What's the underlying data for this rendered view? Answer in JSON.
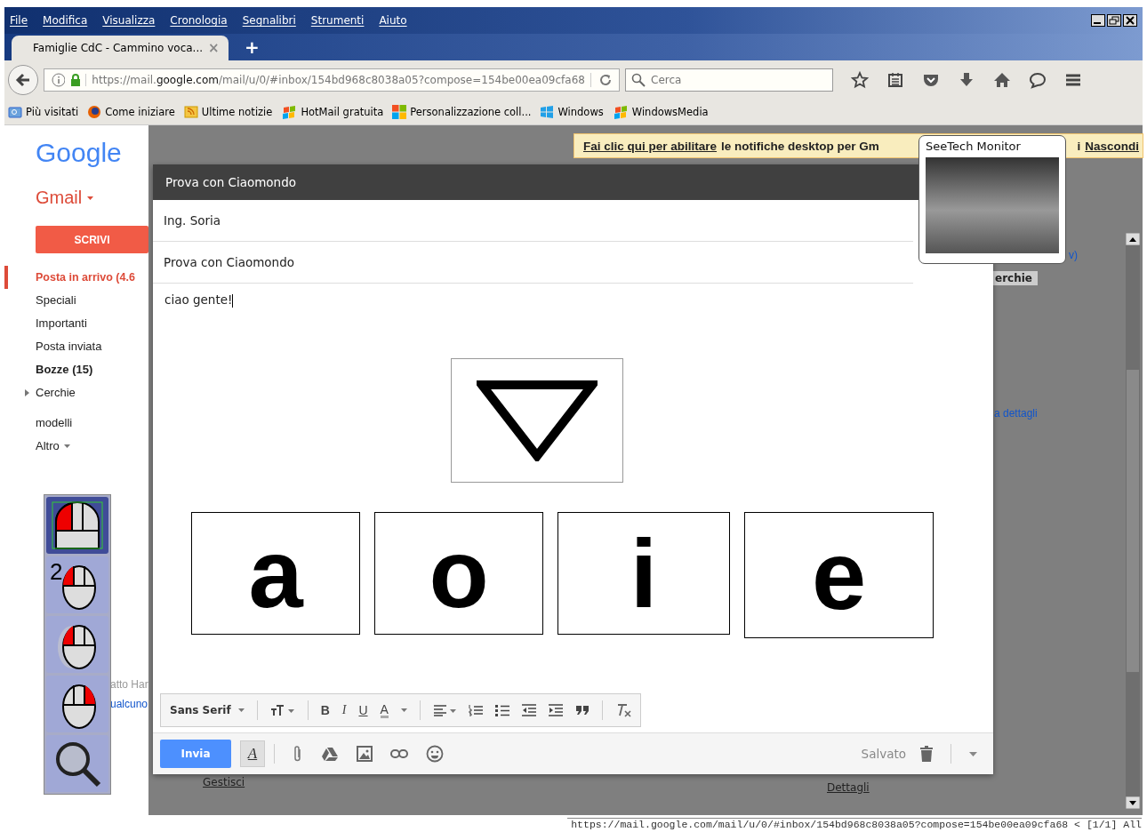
{
  "menu_bar": [
    "File",
    "Modifica",
    "Visualizza",
    "Cronologia",
    "Segnalibri",
    "Strumenti",
    "Aiuto"
  ],
  "tab": {
    "title": "Famiglie CdC - Cammino voca...",
    "close": "×",
    "new_tab": "+"
  },
  "address_bar": {
    "scheme": "https://mail.",
    "host": "google.com",
    "path": "/mail/u/0/#inbox/154bd968c8038a05?compose=154be00ea09cfa68"
  },
  "search_field": {
    "placeholder": "Cerca"
  },
  "bookmarks": [
    {
      "label": "Più visitati",
      "kind": "folder"
    },
    {
      "label": "Come iniziare",
      "kind": "firefox"
    },
    {
      "label": "Ultime notizie",
      "kind": "rss"
    },
    {
      "label": "HotMail gratuita",
      "kind": "flag"
    },
    {
      "label": "Personalizzazione coll...",
      "kind": "tiles"
    },
    {
      "label": "Windows",
      "kind": "windows"
    },
    {
      "label": "WindowsMedia",
      "kind": "flag"
    }
  ],
  "sidebar": {
    "logo": "Google",
    "app": "Gmail",
    "compose_button": "SCRIVI",
    "items": [
      {
        "label": "Posta in arrivo (4.6",
        "selected": true,
        "unread": true,
        "has_children": false
      },
      {
        "label": "Speciali",
        "selected": false,
        "unread": false,
        "has_children": false
      },
      {
        "label": "Importanti",
        "selected": false,
        "unread": false,
        "has_children": false
      },
      {
        "label": "Posta inviata",
        "selected": false,
        "unread": false,
        "has_children": false
      },
      {
        "label": "Bozze (15)",
        "selected": false,
        "unread": true,
        "has_children": false
      },
      {
        "label": "Cerchie",
        "selected": false,
        "unread": false,
        "has_children": true
      }
    ],
    "more_items": [
      {
        "label": "modelli",
        "kind": "link"
      },
      {
        "label": "Altro",
        "kind": "dropdown"
      }
    ]
  },
  "notification": {
    "link": "Fai clic qui per abilitare",
    "text": "le notifiche desktop per Gm",
    "tail": "i",
    "dismiss": "Nascondi"
  },
  "background_fragments": [
    {
      "text": "v)",
      "kind": "link"
    },
    {
      "text": "erchie",
      "kind": "chip"
    },
    {
      "text": "a dettagli",
      "kind": "link"
    },
    {
      "text": "atto Har",
      "kind": "muted"
    },
    {
      "text": "ualcuno",
      "kind": "link"
    },
    {
      "text": "Gestisci",
      "kind": "underlined"
    },
    {
      "text": "Dettagli",
      "kind": "underlined"
    }
  ],
  "compose": {
    "title": "Prova con Ciaomondo",
    "to": "Ing. Soria",
    "subject": "Prova con Ciaomondo",
    "body": "ciao gente!",
    "letter_keys": [
      "a",
      "o",
      "i",
      "e"
    ],
    "format_toolbar": {
      "font": "Sans Serif",
      "buttons": [
        {
          "kind": "size"
        },
        {
          "kind": "bold",
          "glyph": "B"
        },
        {
          "kind": "italic",
          "glyph": "I"
        },
        {
          "kind": "underline",
          "glyph": "U"
        },
        {
          "kind": "color",
          "glyph": "A"
        },
        {
          "kind": "align"
        },
        {
          "kind": "numbered"
        },
        {
          "kind": "bulleted"
        },
        {
          "kind": "outdent"
        },
        {
          "kind": "indent"
        },
        {
          "kind": "quote"
        },
        {
          "kind": "clear"
        }
      ]
    },
    "send_button": "Invia",
    "format_toggle": "A",
    "status": "Salvato"
  },
  "mouse_panel": [
    {
      "kind": "left-click",
      "selected": true
    },
    {
      "kind": "double-click",
      "selected": false,
      "label": "2"
    },
    {
      "kind": "drag",
      "selected": false
    },
    {
      "kind": "right-click",
      "selected": false
    },
    {
      "kind": "magnifier",
      "selected": false
    }
  ],
  "monitor_popup": {
    "title": "SeeTech Monitor"
  },
  "status_bar": {
    "url": "https://mail.google.com/mail/u/0/#inbox/154bd968c8038a05?compose=154be00ea09cfa68 < [1/1] All"
  }
}
